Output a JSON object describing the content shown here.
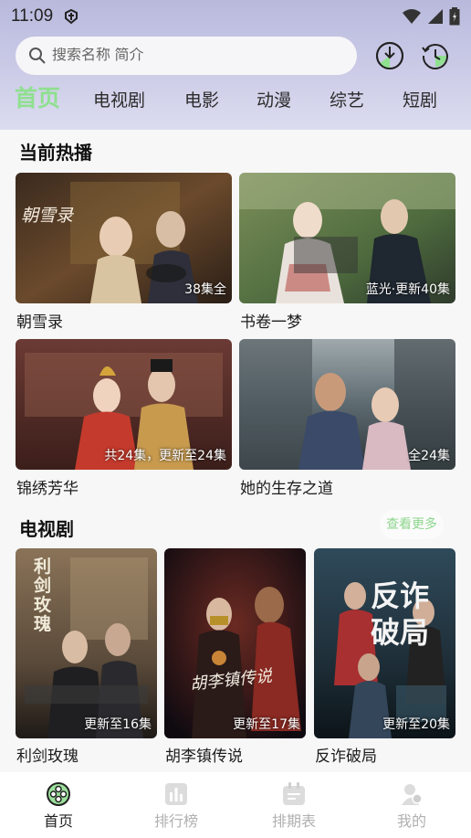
{
  "status_bar": {
    "time": "11:09"
  },
  "search": {
    "placeholder": "搜索名称 简介"
  },
  "tabs": [
    {
      "label": "首页",
      "active": true
    },
    {
      "label": "电视剧"
    },
    {
      "label": "电影"
    },
    {
      "label": "动漫"
    },
    {
      "label": "综艺"
    },
    {
      "label": "短剧"
    }
  ],
  "sections": {
    "hot": {
      "title": "当前热播",
      "items": [
        {
          "title": "朝雪录",
          "badge": "38集全",
          "poster_logo": "朝雪录"
        },
        {
          "title": "书卷一梦",
          "badge": "蓝光·更新40集"
        },
        {
          "title": "锦绣芳华",
          "badge": "共24集，更新至24集"
        },
        {
          "title": "她的生存之道",
          "badge": "全24集"
        }
      ]
    },
    "tv": {
      "title": "电视剧",
      "more_label": "查看更多",
      "items": [
        {
          "title": "利剑玫瑰",
          "badge": "更新至16集",
          "poster_logo": "利剑玫瑰"
        },
        {
          "title": "胡李镇传说",
          "badge": "更新至17集",
          "poster_logo": "胡李镇传说"
        },
        {
          "title": "反诈破局",
          "badge": "更新至20集",
          "poster_logo": "反诈破局"
        }
      ]
    }
  },
  "bottom_nav": [
    {
      "label": "首页",
      "icon": "home-film-icon",
      "active": true
    },
    {
      "label": "排行榜",
      "icon": "chart-icon"
    },
    {
      "label": "排期表",
      "icon": "calendar-icon"
    },
    {
      "label": "我的",
      "icon": "profile-icon"
    }
  ],
  "colors": {
    "accent": "#8fe08f",
    "header_gradient_top": "#b9b9dd",
    "nav_inactive": "#b0b0b0"
  }
}
